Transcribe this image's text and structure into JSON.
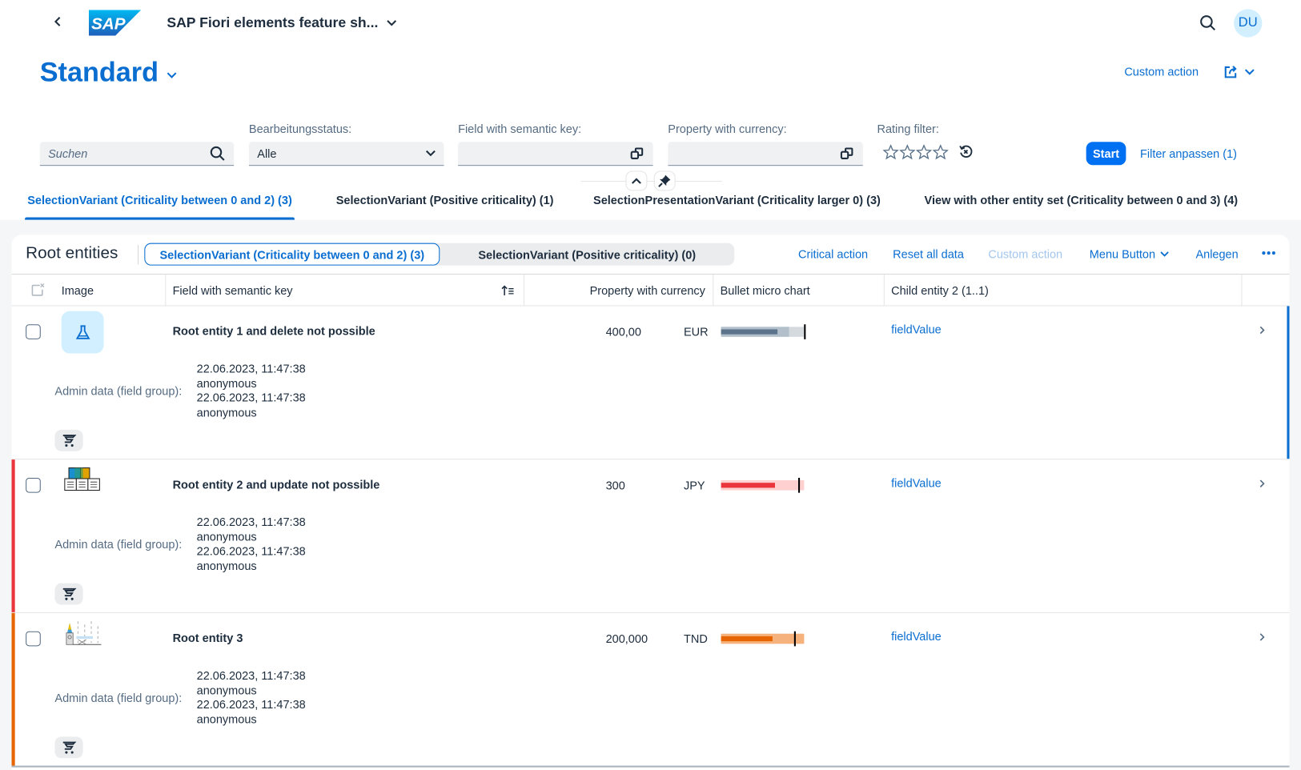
{
  "shell": {
    "app_title": "SAP Fiori elements feature sh...",
    "user_initials": "DU",
    "back_icon": "chevron-left-icon",
    "search_icon": "search-icon"
  },
  "header": {
    "variant_name": "Standard",
    "custom_action": "Custom action",
    "share_icon": "share-icon"
  },
  "filterbar": {
    "search_placeholder": "Suchen",
    "fields": [
      {
        "label": "Bearbeitungsstatus:",
        "value": "Alle"
      },
      {
        "label": "Field with semantic key:",
        "value": ""
      },
      {
        "label": "Property with currency:",
        "value": ""
      },
      {
        "label": "Rating filter:",
        "value": 0,
        "max": 4
      }
    ],
    "start_label": "Start",
    "adapt_label": "Filter anpassen (1)"
  },
  "tabs": [
    {
      "label": "SelectionVariant (Criticality between 0 and 2) (3)",
      "active": true
    },
    {
      "label": "SelectionVariant (Positive criticality) (1)",
      "active": false
    },
    {
      "label": "SelectionPresentationVariant (Criticality larger 0) (3)",
      "active": false
    },
    {
      "label": "View with other entity set (Criticality between 0 and 3) (4)",
      "active": false
    }
  ],
  "table": {
    "title": "Root entities",
    "segments": [
      {
        "label": "SelectionVariant (Criticality between 0 and 2) (3)",
        "selected": true
      },
      {
        "label": "SelectionVariant (Positive criticality) (0)",
        "selected": false
      }
    ],
    "toolbar": {
      "critical_action": "Critical action",
      "reset_all": "Reset all data",
      "custom_action": "Custom action",
      "menu_button": "Menu Button",
      "create": "Anlegen",
      "overflow": "..."
    },
    "columns": [
      "Image",
      "Field with semantic key",
      "Property with currency",
      "Bullet micro chart",
      "Child entity 2 (1..1)"
    ],
    "admin_label": "Admin data (field group):",
    "rows": [
      {
        "title": "Root entity 1 and delete not possible",
        "image": "lab-flask-icon",
        "amount": "400,00",
        "currency": "EUR",
        "criticality": "neutral",
        "color": "#5b738b",
        "bullet": {
          "value": 68,
          "forecast": 82,
          "target": 100,
          "max": 100
        },
        "admin": [
          "22.06.2023, 11:47:38",
          "anonymous",
          "22.06.2023, 11:47:38",
          "anonymous"
        ],
        "child": "fieldValue",
        "selected_nav": true
      },
      {
        "title": "Root entity 2 and update not possible",
        "image": "warehouse-image",
        "amount": "300",
        "currency": "JPY",
        "criticality": "negative",
        "color": "#e9353b",
        "bullet": {
          "value": 65,
          "forecast": 100,
          "target": 93,
          "max": 100
        },
        "admin": [
          "22.06.2023, 11:47:38",
          "anonymous",
          "22.06.2023, 11:47:38",
          "anonymous"
        ],
        "child": "fieldValue",
        "selected_nav": false
      },
      {
        "title": "Root entity 3",
        "image": "landmark-image",
        "amount": "200,000",
        "currency": "TND",
        "criticality": "critical",
        "color": "#e76500",
        "bullet": {
          "value": 62,
          "forecast": 100,
          "target": 88,
          "max": 100
        },
        "admin": [
          "22.06.2023, 11:47:38",
          "anonymous",
          "22.06.2023, 11:47:38",
          "anonymous"
        ],
        "child": "fieldValue",
        "selected_nav": false
      }
    ]
  }
}
